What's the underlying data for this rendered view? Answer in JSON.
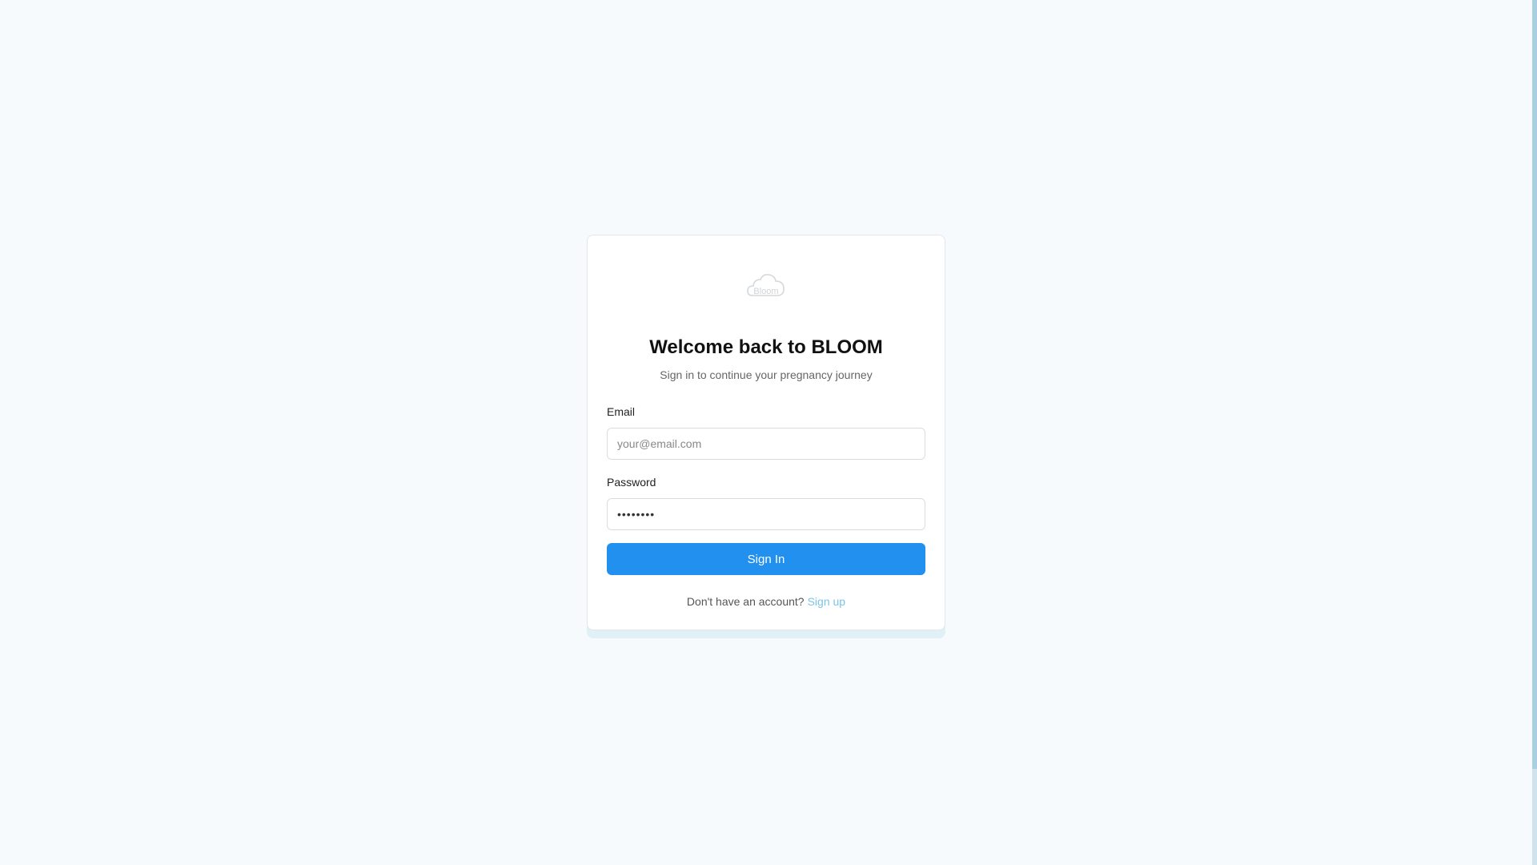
{
  "theme": {
    "page_background": "#f7fafd",
    "accent": "#2290ef",
    "link": "#7cc4e6",
    "card_background": "#ffffff"
  },
  "logo": {
    "icon": "cloud-logo-icon",
    "text": "Bloom"
  },
  "header": {
    "title": "Welcome back to BLOOM",
    "subtitle": "Sign in to continue your pregnancy journey"
  },
  "form": {
    "email": {
      "label": "Email",
      "placeholder": "your@email.com",
      "value": ""
    },
    "password": {
      "label": "Password",
      "value": "••••••••"
    },
    "submit_label": "Sign In"
  },
  "footer": {
    "prompt": "Don't have an account?",
    "link_label": "Sign up"
  }
}
